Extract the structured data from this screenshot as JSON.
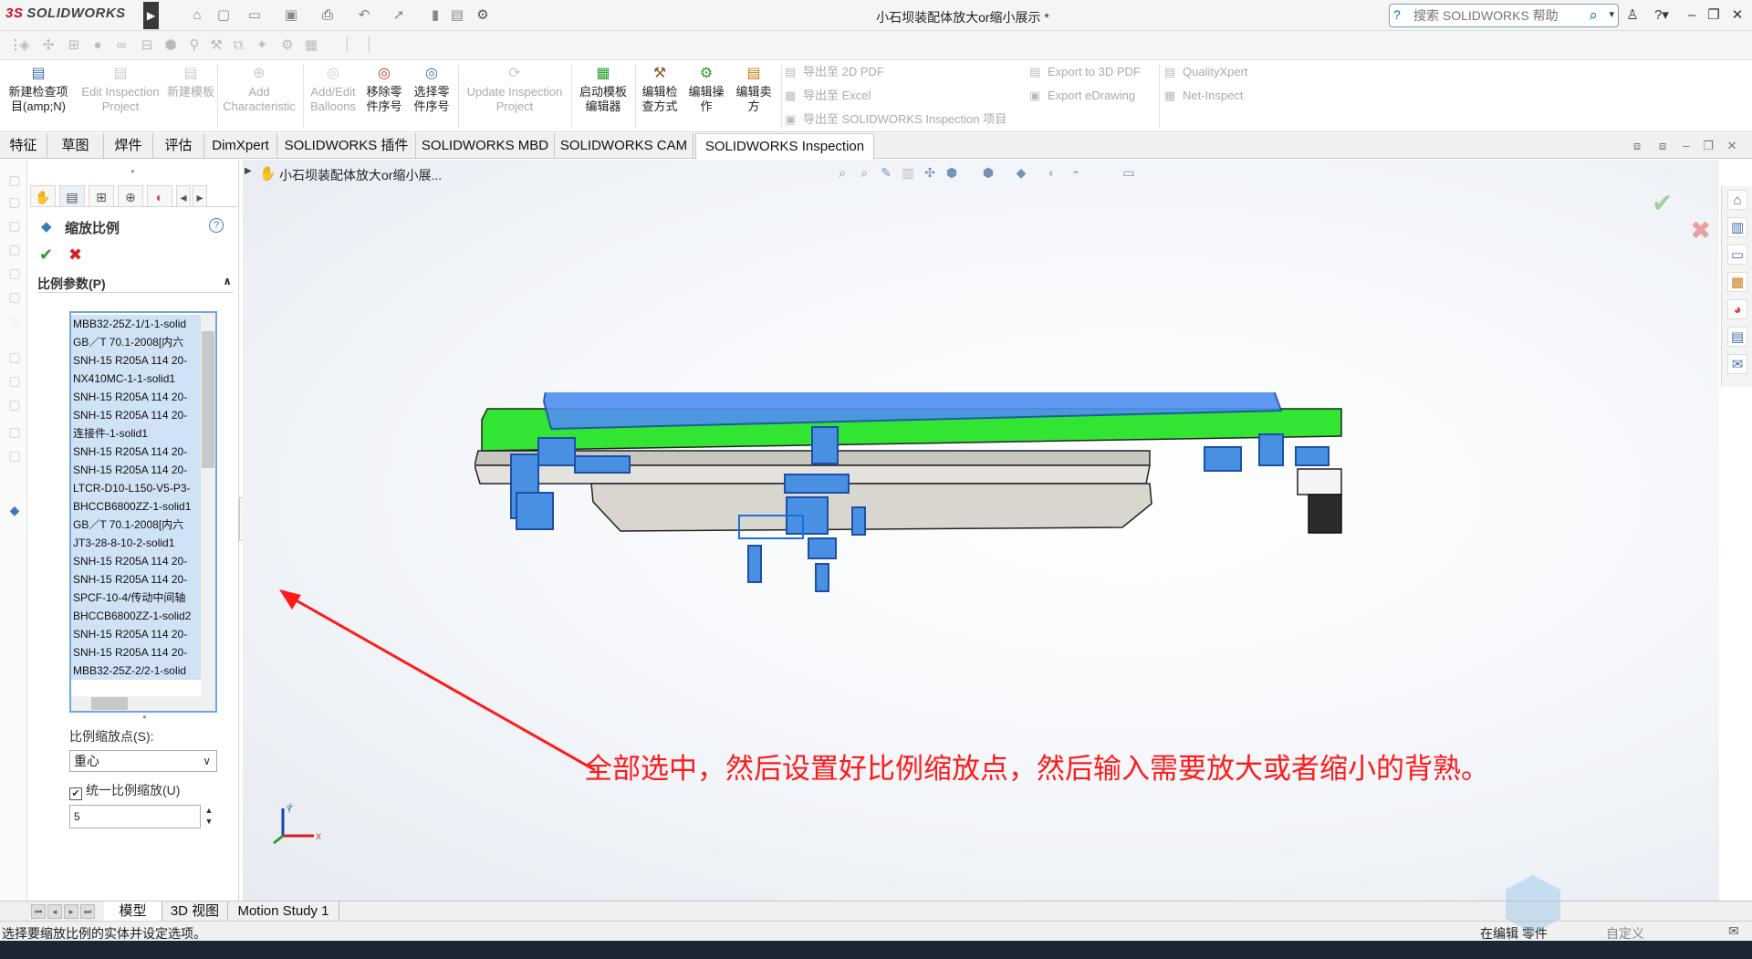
{
  "app": {
    "logo_text": "SOLIDWORKS",
    "window_title": "小石坝装配体放大or缩小展示 *"
  },
  "search": {
    "placeholder": "搜索 SOLIDWORKS 帮助"
  },
  "ribbon": {
    "buttons": [
      {
        "label": "新建检查项目(amp;N)",
        "enabled": true
      },
      {
        "label": "Edit Inspection Project",
        "enabled": false
      },
      {
        "label": "新建模板",
        "enabled": false
      },
      {
        "label": "Add Characteristic",
        "enabled": false
      },
      {
        "label": "Add/Edit Balloons",
        "enabled": false
      },
      {
        "label": "移除零件序号",
        "enabled": true
      },
      {
        "label": "选择零件序号",
        "enabled": true
      },
      {
        "label": "Update Inspection Project",
        "enabled": false
      },
      {
        "label": "启动模板编辑器",
        "enabled": true
      },
      {
        "label": "编辑检查方式",
        "enabled": true
      },
      {
        "label": "编辑操作",
        "enabled": true
      },
      {
        "label": "编辑卖方",
        "enabled": true
      }
    ],
    "export": [
      "导出至 2D PDF",
      "导出至 Excel",
      "导出至 SOLIDWORKS Inspection 项目",
      "Export to 3D PDF",
      "Export eDrawing",
      "QualityXpert",
      "Net-Inspect"
    ]
  },
  "tabs": [
    "特征",
    "草图",
    "焊件",
    "评估",
    "DimXpert",
    "SOLIDWORKS 插件",
    "SOLIDWORKS MBD",
    "SOLIDWORKS CAM",
    "SOLIDWORKS Inspection"
  ],
  "active_tab": "SOLIDWORKS Inspection",
  "property_manager": {
    "title": "缩放比例",
    "group_title": "比例参数(P)",
    "entities": [
      "MBB32-25Z-1/1-1-solid",
      "GB／T 70.1-2008[内六",
      "SNH-15 R205A 114 20-",
      "NX410MC-1-1-solid1",
      "SNH-15 R205A 114 20-",
      "SNH-15 R205A 114 20-",
      "连接件-1-solid1",
      "SNH-15 R205A 114 20-",
      "SNH-15 R205A 114 20-",
      "LTCR-D10-L150-V5-P3-",
      "BHCCB6800ZZ-1-solid1",
      "GB／T 70.1-2008[内六",
      "JT3-28-8-10-2-solid1",
      "SNH-15 R205A 114 20-",
      "SNH-15 R205A 114 20-",
      "SPCF-10-4/传动中间轴",
      "BHCCB6800ZZ-1-solid2",
      "SNH-15 R205A 114 20-",
      "SNH-15 R205A 114 20-",
      "MBB32-25Z-2/2-1-solid"
    ],
    "scale_point_label": "比例缩放点(S):",
    "scale_point_value": "重心",
    "uniform_label": "统一比例缩放(U)",
    "uniform_checked": true,
    "scale_value": "5"
  },
  "viewport": {
    "tree_name": "小石坝装配体放大or缩小展...",
    "annotation": "全部选中，然后设置好比例缩放点，然后输入需要放大或者缩小的背熟。",
    "annotation_color": "#ff1a1a"
  },
  "bottom_tabs": [
    "模型",
    "3D 视图",
    "Motion Study 1"
  ],
  "status": {
    "message": "选择要缩放比例的实体并设定选项。",
    "mode": "在编辑 零件",
    "custom": "自定义"
  }
}
